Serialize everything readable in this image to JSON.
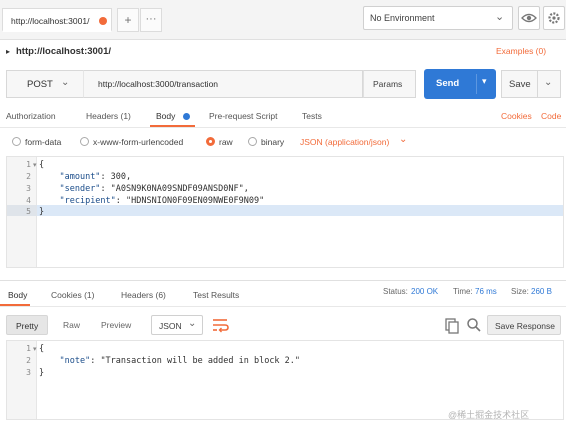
{
  "tabs": {
    "active_tab": "http://localhost:3001/",
    "new_tab": "+",
    "more": "···"
  },
  "env": {
    "selected": "No Environment"
  },
  "breadcrumb": "http://localhost:3001/",
  "examples": "Examples (0)",
  "request": {
    "method": "POST",
    "url": "http://localhost:3000/transaction",
    "params_label": "Params",
    "send_label": "Send",
    "save_label": "Save"
  },
  "request_tabs": [
    {
      "label": "Authorization"
    },
    {
      "label": "Headers (1)"
    },
    {
      "label": "Body"
    },
    {
      "label": "Pre-request Script"
    },
    {
      "label": "Tests"
    }
  ],
  "request_links": {
    "cookies": "Cookies",
    "code": "Code"
  },
  "body_types": [
    {
      "label": "form-data",
      "selected": false
    },
    {
      "label": "x-www-form-urlencoded",
      "selected": false
    },
    {
      "label": "raw",
      "selected": true
    },
    {
      "label": "binary",
      "selected": false
    }
  ],
  "content_type": "JSON (application/json)",
  "request_body": [
    {
      "n": "1",
      "text": "{"
    },
    {
      "n": "2",
      "indent": "    ",
      "key": "\"amount\"",
      "rest": ": 300,"
    },
    {
      "n": "3",
      "indent": "    ",
      "key": "\"sender\"",
      "rest": ": \"A0SN9K0NA09SNDF09ANSD0NF\","
    },
    {
      "n": "4",
      "indent": "    ",
      "key": "\"recipient\"",
      "rest": ": \"HDNSNION0F09EN09NWE0F9N09\""
    },
    {
      "n": "5",
      "text": "}"
    }
  ],
  "response_tabs": [
    {
      "label": "Body"
    },
    {
      "label": "Cookies (1)"
    },
    {
      "label": "Headers (6)"
    },
    {
      "label": "Test Results"
    }
  ],
  "response_status": {
    "status_label": "Status:",
    "status_value": "200 OK",
    "time_label": "Time:",
    "time_value": "76 ms",
    "size_label": "Size:",
    "size_value": "260 B"
  },
  "response_toolbar": {
    "pretty": "Pretty",
    "raw": "Raw",
    "preview": "Preview",
    "format": "JSON",
    "save_response": "Save Response"
  },
  "response_body": [
    {
      "n": "1",
      "text": "{"
    },
    {
      "n": "2",
      "indent": "    ",
      "key": "\"note\"",
      "rest": ": \"Transaction will be added in block 2.\""
    },
    {
      "n": "3",
      "text": "}"
    }
  ],
  "watermark": "@稀土掘金技术社区",
  "colors": {
    "accent_orange": "#f26b3a",
    "send_blue": "#2f79d6"
  }
}
